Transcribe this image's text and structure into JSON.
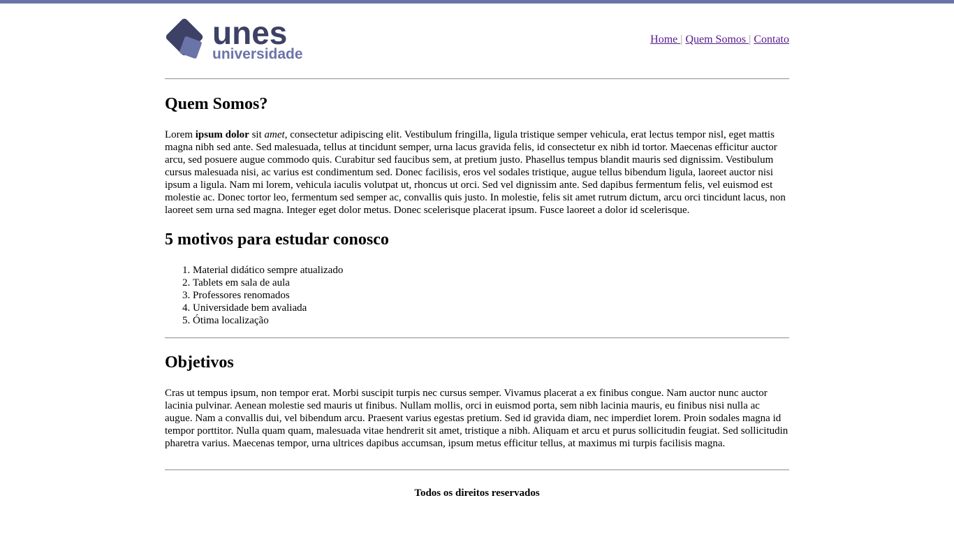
{
  "theme": {
    "accent": "#6b74a8",
    "logo_dark": "#3d4166",
    "logo_light": "#6b74a8",
    "link": "#551a8b"
  },
  "logo": {
    "brand": "unes",
    "tagline": "universidade"
  },
  "nav": {
    "items": [
      {
        "label": "Home "
      },
      {
        "label": "Quem Somos "
      },
      {
        "label": "Contato"
      }
    ],
    "separator": "|"
  },
  "about": {
    "title": "Quem Somos?",
    "lead_1": "Lorem ",
    "lead_bold": "ipsum dolor",
    "lead_2": " sit ",
    "lead_italic": "amet",
    "body": ", consectetur adipiscing elit. Vestibulum fringilla, ligula tristique semper vehicula, erat lectus tempor nisl, eget mattis magna nibh sed ante. Sed malesuada, tellus at tincidunt semper, urna lacus gravida felis, id consectetur ex nibh id tortor. Maecenas efficitur auctor arcu, sed posuere augue commodo quis. Curabitur sed faucibus sem, at pretium justo. Phasellus tempus blandit mauris sed dignissim. Vestibulum cursus malesuada nisi, ac varius est condimentum sed. Donec facilisis, eros vel sodales tristique, augue tellus bibendum ligula, laoreet auctor nisi ipsum a ligula. Nam mi lorem, vehicula iaculis volutpat ut, rhoncus ut orci. Sed vel dignissim ante. Sed dapibus fermentum felis, vel euismod est molestie ac. Donec tortor leo, fermentum sed semper ac, convallis quis justo. In molestie, felis sit amet rutrum dictum, arcu orci tincidunt lacus, non laoreet sem urna sed magna. Integer eget dolor metus. Donec scelerisque placerat ipsum. Fusce laoreet a dolor id scelerisque."
  },
  "reasons": {
    "title": "5 motivos para estudar conosco",
    "items": [
      "Material didático sempre atualizado",
      "Tablets em sala de aula",
      "Professores renomados",
      "Universidade bem avaliada",
      "Ótima localização"
    ]
  },
  "goals": {
    "title": "Objetivos",
    "body": "Cras ut tempus ipsum, non tempor erat. Morbi suscipit turpis nec cursus semper. Vivamus placerat a ex finibus congue. Nam auctor nunc auctor lacinia pulvinar. Aenean molestie sed mauris ut finibus. Nullam mollis, orci in euismod porta, sem nibh lacinia mauris, eu finibus nisi nulla ac augue. Nam a convallis dui, vel bibendum arcu. Praesent varius egestas pretium. Sed id gravida diam, nec imperdiet lorem. Proin sodales magna id tempor porttitor. Nulla quam quam, malesuada vitae hendrerit sit amet, tristique a nibh. Aliquam et arcu et purus sollicitudin feugiat. Sed sollicitudin pharetra varius. Maecenas tempor, urna ultrices dapibus accumsan, ipsum metus efficitur tellus, at maximus mi turpis facilisis magna."
  },
  "footer": {
    "text": "Todos os direitos reservados"
  }
}
